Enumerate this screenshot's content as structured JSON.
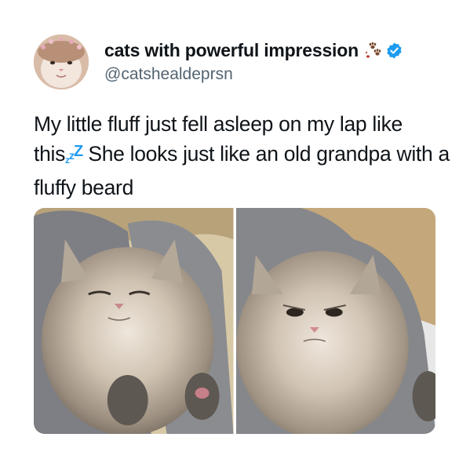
{
  "tweet": {
    "author": {
      "display_name": "cats with powerful impression",
      "handle": "@catshealdeprsn",
      "avatar_icon": "cat-face-avatar",
      "badge_emoji_icon": "paw-prints-icon",
      "verified_icon": "verified-badge-icon"
    },
    "text": {
      "line_part1": "My little fluff just fell asleep on my lap like this",
      "zzz": [
        "z",
        "z",
        "Z"
      ],
      "line_part2": "She looks just like an old grandpa with a fluffy beard"
    },
    "media": [
      {
        "alt": "fluffy grey kitten sleeping on lap with eyes closed",
        "icon": "photo-sleeping-kitten"
      },
      {
        "alt": "fluffy grey kitten with grumpy open eyes on lap",
        "icon": "photo-grumpy-kitten"
      }
    ],
    "colors": {
      "text": "#0f1419",
      "handle": "#536471",
      "verified": "#1d9bf0",
      "accent_zzz": "#1d9bf0"
    }
  }
}
